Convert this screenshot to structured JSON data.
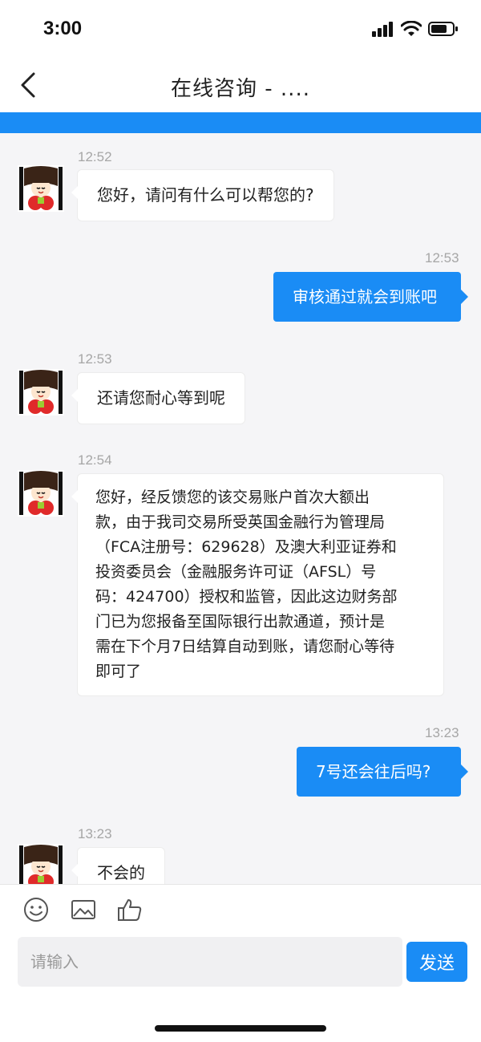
{
  "status_bar": {
    "time": "3:00"
  },
  "nav": {
    "title": "在线咨询 - ...."
  },
  "messages": [
    {
      "side": "in",
      "time": "12:52",
      "text": "您好，请问有什么可以帮您的?"
    },
    {
      "side": "out",
      "time": "12:53",
      "text": "审核通过就会到账吧"
    },
    {
      "side": "in",
      "time": "12:53",
      "text": "还请您耐心等到呢"
    },
    {
      "side": "in",
      "time": "12:54",
      "lines": [
        "您好，经反馈您的该交易账户首次大额出",
        "款，由于我司交易所受英国金融行为管理局",
        "（FCA注册号：629628）及澳大利亚证券和",
        "投资委员会（金融服务许可证（AFSL）号",
        "码：424700）授权和监管，因此这边财务部",
        "门已为您报备至国际银行出款通道，预计是",
        "需在下个月7日结算自动到账，请您耐心等待",
        "即可了"
      ]
    },
    {
      "side": "out",
      "time": "13:23",
      "text": "7号还会往后吗?"
    },
    {
      "side": "in",
      "time": "13:23",
      "text": "不会的"
    }
  ],
  "toolbar": {
    "icons": [
      "emoji-icon",
      "image-icon",
      "thumbs-up-icon"
    ]
  },
  "input": {
    "placeholder": "请输入",
    "value": ""
  },
  "send": {
    "label": "发送"
  },
  "colors": {
    "accent": "#1a8cf5",
    "chat_bg": "#f5f5f7"
  }
}
